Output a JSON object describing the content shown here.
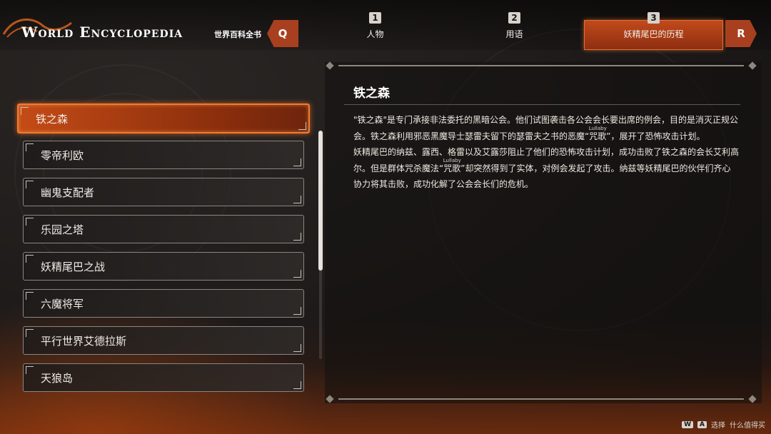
{
  "header": {
    "title_en": "World Encyclopedia",
    "title_zh": "世界百科全书",
    "prev_key": "Q",
    "next_key": "R",
    "accent_color": "#c14a1c"
  },
  "tabs": [
    {
      "num": "1",
      "label": "人物",
      "active": false
    },
    {
      "num": "2",
      "label": "用语",
      "active": false
    },
    {
      "num": "3",
      "label": "妖精尾巴的历程",
      "active": true
    }
  ],
  "list": {
    "items": [
      {
        "label": "铁之森",
        "selected": true
      },
      {
        "label": "零帝利欧",
        "selected": false
      },
      {
        "label": "幽鬼支配者",
        "selected": false
      },
      {
        "label": "乐园之塔",
        "selected": false
      },
      {
        "label": "妖精尾巴之战",
        "selected": false
      },
      {
        "label": "六魔将军",
        "selected": false
      },
      {
        "label": "平行世界艾德拉斯",
        "selected": false
      },
      {
        "label": "天狼岛",
        "selected": false
      }
    ]
  },
  "entry": {
    "title": "铁之森",
    "p1_a": "\"铁之森\"是专门承接非法委托的黑暗公会。他们试图袭击各公会会长要出席的例会，目的是消灭正规公会。铁之森利用邪恶黑魔导士瑟雷夫留下的瑟雷夫之书的恶魔",
    "p1_ruby": "“咒歌”",
    "p1_ruby_rt": "Lullaby",
    "p1_b": "，展开了恐怖攻击计划。",
    "p2_a": "妖精尾巴的纳兹、露西、格雷以及艾露莎阻止了他们的恐怖攻击计划，成功击败了铁之森的会长艾利高尔。但是群体咒杀魔法",
    "p2_ruby": "“咒歌”",
    "p2_ruby_rt": "Lullaby",
    "p2_b": "却突然得到了实体，对例会发起了攻击。纳兹等妖精尾巴的伙伴们齐心协力将其击败，成功化解了公会会长们的危机。"
  },
  "footer": {
    "hint_text": "选择",
    "watermark": "什么值得买"
  }
}
